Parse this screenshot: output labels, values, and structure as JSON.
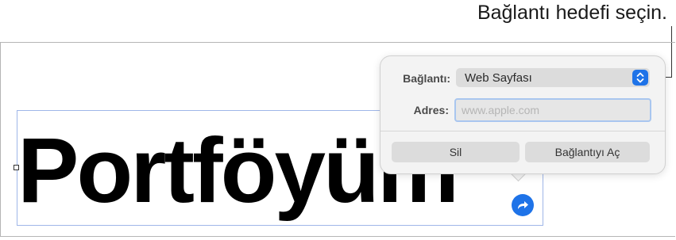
{
  "callout": {
    "text": "Bağlantı hedefi seçin."
  },
  "document": {
    "text_box_content": "Portföyüm"
  },
  "link_popover": {
    "link_label": "Bağlantı:",
    "link_type_value": "Web Sayfası",
    "address_label": "Adres:",
    "address_placeholder": "www.apple.com",
    "delete_button": "Sil",
    "open_link_button": "Bağlantıyı Aç"
  },
  "icons": {
    "select_chevron": "chevron-up-down-icon",
    "link_arrow": "arrow-forward-circle-icon"
  },
  "colors": {
    "accent": "#1e73e8",
    "selection_border": "#9fb6e8",
    "input_focus_border": "#a9c6ef",
    "popover_bg": "#f3f3f3"
  }
}
